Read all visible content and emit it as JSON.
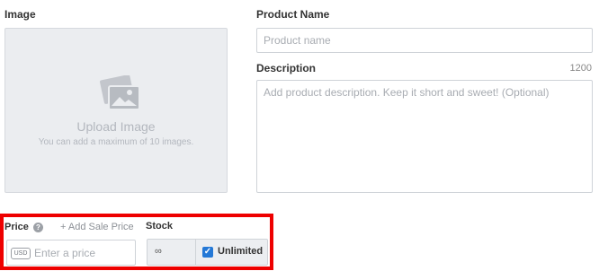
{
  "image_section": {
    "label": "Image",
    "upload_title": "Upload Image",
    "upload_subtitle": "You can add a maximum of 10 images."
  },
  "product_name": {
    "label": "Product Name",
    "placeholder": "Product name",
    "value": ""
  },
  "description": {
    "label": "Description",
    "char_limit": "1200",
    "placeholder": "Add product description. Keep it short and sweet! (Optional)",
    "value": ""
  },
  "price": {
    "label": "Price",
    "help_icon": "question-circle-icon",
    "add_sale_link": "+ Add Sale Price",
    "currency": "USD",
    "placeholder": "Enter a price",
    "value": ""
  },
  "stock": {
    "label": "Stock",
    "value": "∞",
    "unlimited_label": "Unlimited",
    "unlimited_checked": true
  },
  "colors": {
    "highlight": "#ee0000",
    "checkbox": "#2478d6"
  }
}
